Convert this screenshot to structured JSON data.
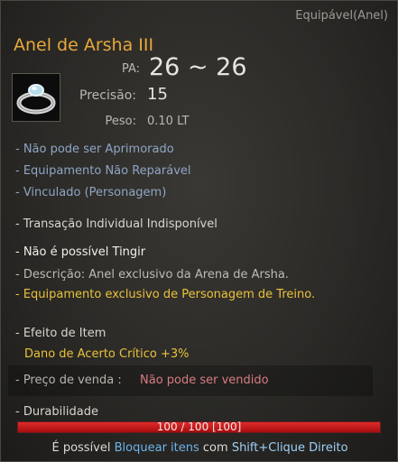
{
  "tooltip": {
    "category": "Equipável(Anel)",
    "item_name": "Anel de Arsha III",
    "icon": "silver-ring-icon",
    "stats": {
      "pa_label": "PA:",
      "pa_value": "26 ~ 26",
      "precision_label": "Precisão:",
      "precision_value": "15",
      "weight_label": "Peso:",
      "weight_value": "0.10 LT"
    },
    "properties": [
      "- Não pode ser Aprimorado",
      "- Equipamento Não Reparável",
      "- Vinculado (Personagem)"
    ],
    "transaction": "- Transação Individual Indisponível",
    "dye": "- Não é possível Tingir",
    "description": "- Descrição: Anel exclusivo da Arena de Arsha.",
    "exclusive": "- Equipamento exclusivo de Personagem de Treino.",
    "effect_title": "- Efeito de Item",
    "effect_value": "Dano de Acerto Crítico +3%",
    "sell_label": "- Preço de venda :",
    "sell_value": "Não pode ser vendido",
    "durability_label": "- Durabilidade",
    "durability_text": "100 / 100  [100]",
    "durability_fraction": 1.0,
    "hint_prefix": "É possível",
    "hint_link": "Bloquear itens",
    "hint_middle": "com",
    "hint_key": "Shift+Clique Direito"
  }
}
